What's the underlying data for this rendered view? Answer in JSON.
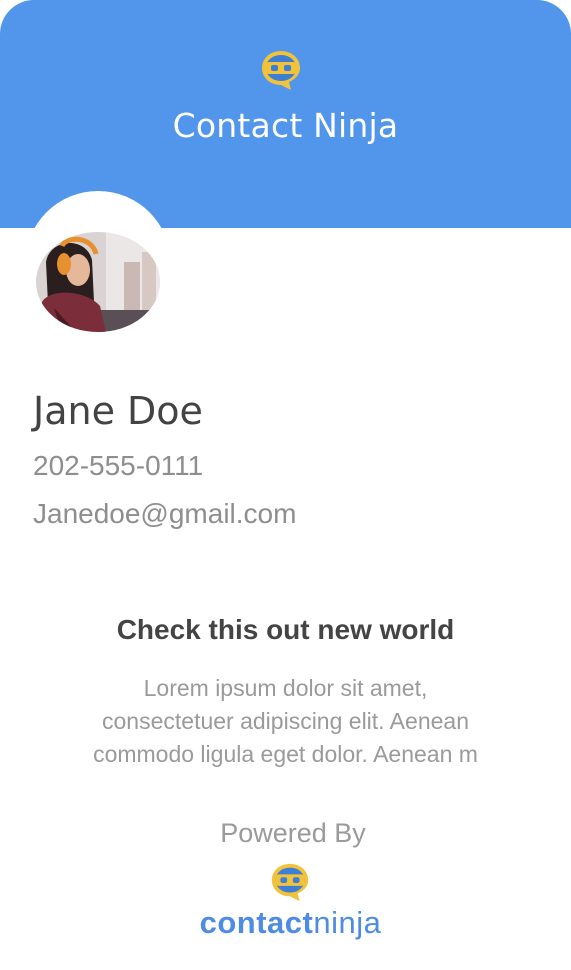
{
  "header": {
    "title": "Contact Ninja",
    "background_color": "#5196EA",
    "logo_icon": "ninja-chat-bubble-icon"
  },
  "profile": {
    "avatar_icon": "profile-photo",
    "name": "Jane Doe",
    "phone": "202-555-0111",
    "email": "Janedoe@gmail.com"
  },
  "promo": {
    "headline": "Check this out new world",
    "body": "Lorem ipsum dolor sit amet,\nconsectetuer adipiscing elit. Aenean\ncommodo ligula eget dolor. Aenean m"
  },
  "footer": {
    "powered_by": "Powered By",
    "logo_icon": "ninja-chat-bubble-icon",
    "brand_bold": "contact",
    "brand_light": "ninja",
    "brand_color": "#4E8CE3"
  }
}
